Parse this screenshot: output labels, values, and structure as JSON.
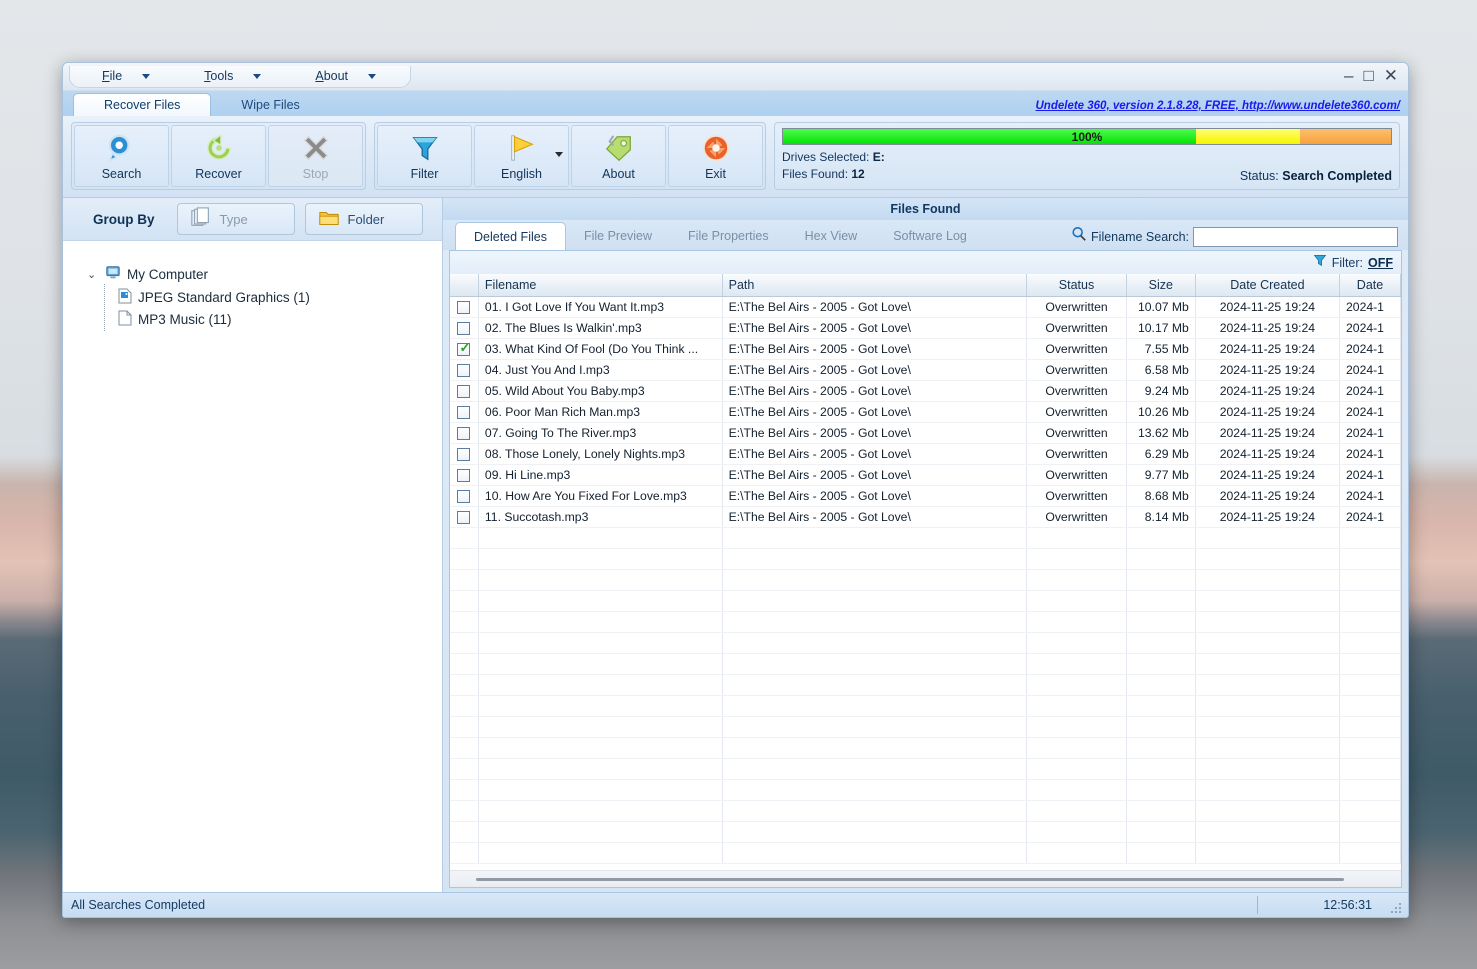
{
  "window": {
    "version_link": "Undelete 360, version 2.1.8.28, FREE, http://www.undelete360.com/",
    "minimize": "–",
    "maximize": "□",
    "close": "✕"
  },
  "menu": [
    {
      "label": "File",
      "accel": "F"
    },
    {
      "label": "Tools",
      "accel": "T"
    },
    {
      "label": "About",
      "accel": "A"
    }
  ],
  "top_tabs": [
    {
      "label": "Recover Files",
      "active": true
    },
    {
      "label": "Wipe Files",
      "active": false
    }
  ],
  "toolbar": {
    "group1": [
      {
        "label": "Search",
        "icon": "magnifier-icon",
        "disabled": false
      },
      {
        "label": "Recover",
        "icon": "recover-arrow-icon",
        "disabled": false
      },
      {
        "label": "Stop",
        "icon": "stop-x-icon",
        "disabled": true
      }
    ],
    "group2": [
      {
        "label": "Filter",
        "icon": "funnel-icon",
        "dropdown": false
      },
      {
        "label": "English",
        "icon": "flag-icon",
        "dropdown": true
      },
      {
        "label": "About",
        "icon": "tag-icon",
        "dropdown": false
      },
      {
        "label": "Exit",
        "icon": "exit-shutter-icon",
        "dropdown": false
      }
    ]
  },
  "progress": {
    "percent_label": "100%",
    "percent": 100,
    "drives_label": "Drives Selected:",
    "drives_value": "E:",
    "files_label": "Files Found:",
    "files_value": "12",
    "status_label": "Status:",
    "status_value": "Search Completed",
    "color_green": "#06e206",
    "color_yellow": "#f5f500",
    "color_orange": "#f6a23c"
  },
  "sidebar": {
    "group_by_label": "Group By",
    "buttons": [
      {
        "label": "Type",
        "icon": "documents-icon",
        "active": false
      },
      {
        "label": "Folder",
        "icon": "folder-icon",
        "active": true
      }
    ],
    "tree": {
      "root": {
        "label": "My Computer",
        "icon": "computer-icon",
        "expanded": true
      },
      "children": [
        {
          "label": "JPEG Standard Graphics (1)",
          "icon": "jpeg-file-icon"
        },
        {
          "label": "MP3 Music (11)",
          "icon": "generic-file-icon"
        }
      ]
    }
  },
  "main": {
    "panel_title": "Files Found",
    "tabs": [
      {
        "label": "Deleted Files",
        "active": true
      },
      {
        "label": "File Preview",
        "active": false
      },
      {
        "label": "File Properties",
        "active": false
      },
      {
        "label": "Hex View",
        "active": false
      },
      {
        "label": "Software Log",
        "active": false
      }
    ],
    "search": {
      "label": "Filename Search:",
      "value": "",
      "placeholder": "",
      "icon": "search-icon"
    },
    "filter": {
      "label": "Filter:",
      "state": "OFF",
      "icon": "funnel-icon"
    },
    "columns": [
      "",
      "Filename",
      "Path",
      "Status",
      "Size",
      "Date Created",
      "Date"
    ],
    "rows": [
      {
        "checked": false,
        "filename": "01. I Got Love If You Want It.mp3",
        "path": "E:\\The Bel Airs - 2005 - Got Love\\",
        "status": "Overwritten",
        "size": "10.07 Mb",
        "created": "2024-11-25 19:24",
        "date": "2024-1"
      },
      {
        "checked": false,
        "filename": "02. The Blues Is Walkin'.mp3",
        "path": "E:\\The Bel Airs - 2005 - Got Love\\",
        "status": "Overwritten",
        "size": "10.17 Mb",
        "created": "2024-11-25 19:24",
        "date": "2024-1"
      },
      {
        "checked": true,
        "filename": "03. What Kind Of Fool (Do You Think ...",
        "path": "E:\\The Bel Airs - 2005 - Got Love\\",
        "status": "Overwritten",
        "size": "7.55 Mb",
        "created": "2024-11-25 19:24",
        "date": "2024-1"
      },
      {
        "checked": false,
        "filename": "04. Just You And I.mp3",
        "path": "E:\\The Bel Airs - 2005 - Got Love\\",
        "status": "Overwritten",
        "size": "6.58 Mb",
        "created": "2024-11-25 19:24",
        "date": "2024-1"
      },
      {
        "checked": false,
        "filename": "05. Wild About You Baby.mp3",
        "path": "E:\\The Bel Airs - 2005 - Got Love\\",
        "status": "Overwritten",
        "size": "9.24 Mb",
        "created": "2024-11-25 19:24",
        "date": "2024-1"
      },
      {
        "checked": false,
        "filename": "06. Poor Man Rich Man.mp3",
        "path": "E:\\The Bel Airs - 2005 - Got Love\\",
        "status": "Overwritten",
        "size": "10.26 Mb",
        "created": "2024-11-25 19:24",
        "date": "2024-1"
      },
      {
        "checked": false,
        "filename": "07. Going To The River.mp3",
        "path": "E:\\The Bel Airs - 2005 - Got Love\\",
        "status": "Overwritten",
        "size": "13.62 Mb",
        "created": "2024-11-25 19:24",
        "date": "2024-1"
      },
      {
        "checked": false,
        "filename": "08. Those Lonely, Lonely Nights.mp3",
        "path": "E:\\The Bel Airs - 2005 - Got Love\\",
        "status": "Overwritten",
        "size": "6.29 Mb",
        "created": "2024-11-25 19:24",
        "date": "2024-1"
      },
      {
        "checked": false,
        "filename": "09. Hi Line.mp3",
        "path": "E:\\The Bel Airs - 2005 - Got Love\\",
        "status": "Overwritten",
        "size": "9.77 Mb",
        "created": "2024-11-25 19:24",
        "date": "2024-1"
      },
      {
        "checked": false,
        "filename": "10. How Are You Fixed For Love.mp3",
        "path": "E:\\The Bel Airs - 2005 - Got Love\\",
        "status": "Overwritten",
        "size": "8.68 Mb",
        "created": "2024-11-25 19:24",
        "date": "2024-1"
      },
      {
        "checked": false,
        "filename": "11. Succotash.mp3",
        "path": "E:\\The Bel Airs - 2005 - Got Love\\",
        "status": "Overwritten",
        "size": "8.14 Mb",
        "created": "2024-11-25 19:24",
        "date": "2024-1"
      }
    ],
    "empty_row_count": 16
  },
  "statusbar": {
    "message": "All Searches Completed",
    "clock": "12:56:31"
  },
  "colors": {
    "status_red": "#e8372f",
    "link_blue": "#1a1aee",
    "accent_blue": "#123a63"
  }
}
